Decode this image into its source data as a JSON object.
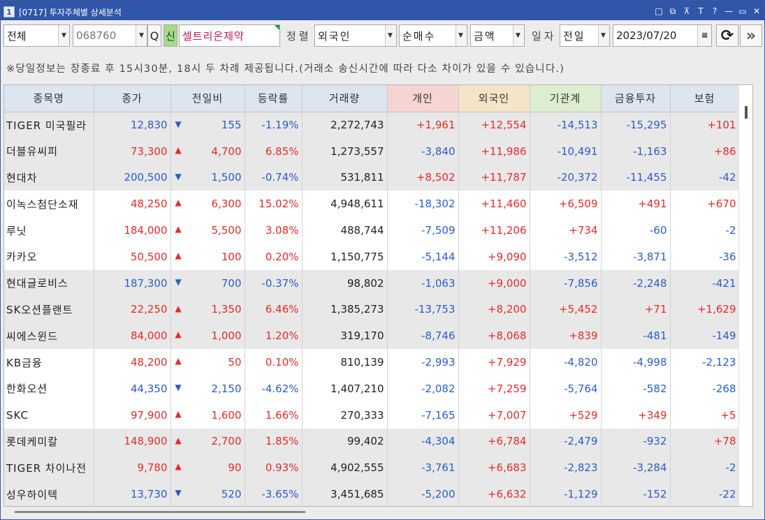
{
  "window": {
    "number": "1",
    "title": "[0717] 투자주체별 상세분석",
    "title_buttons": [
      "□",
      "⧉",
      "⊼",
      "T",
      "?",
      "—",
      "▭",
      "✕"
    ]
  },
  "toolbar": {
    "market": "전체",
    "code": "068760",
    "search_icon": "Q",
    "badge": "신",
    "stock_name": "셀트리온제약",
    "sort_label": "정렬",
    "sort_by": "외국인",
    "trade_type": "순매수",
    "unit": "금액",
    "date_label": "일자",
    "date_mode": "전일",
    "date": "2023/07/20",
    "calendar_icon": "▦",
    "refresh_icon": "⟳",
    "next_icon": "»"
  },
  "notice": "※당일정보는 장종료 후 15시30분, 18시 두 차례 제공됩니다.(거래소 송신시간에 따라 다소 차이가 있을 수 있습니다.)",
  "table": {
    "headers": [
      "종목명",
      "종가",
      "전일비",
      "등락률",
      "거래량",
      "개인",
      "외국인",
      "기관계",
      "금융투자",
      "보험"
    ],
    "rows": [
      {
        "name": "TIGER 미국필라",
        "price": "12,830",
        "dir": "dn",
        "chg": "155",
        "rate": "-1.19%",
        "vol": "2,272,743",
        "ind": "+1,961",
        "for": "+12,554",
        "ins": "-14,513",
        "fin": "-15,295",
        "insu": "+101"
      },
      {
        "name": "더블유씨피",
        "price": "73,300",
        "dir": "up",
        "chg": "4,700",
        "rate": "6.85%",
        "vol": "1,273,557",
        "ind": "-3,840",
        "for": "+11,986",
        "ins": "-10,491",
        "fin": "-1,163",
        "insu": "+86"
      },
      {
        "name": "현대차",
        "price": "200,500",
        "dir": "dn",
        "chg": "1,500",
        "rate": "-0.74%",
        "vol": "531,811",
        "ind": "+8,502",
        "for": "+11,787",
        "ins": "-20,372",
        "fin": "-11,455",
        "insu": "-42"
      },
      {
        "name": "이녹스첨단소재",
        "price": "48,250",
        "dir": "up",
        "chg": "6,300",
        "rate": "15.02%",
        "vol": "4,948,611",
        "ind": "-18,302",
        "for": "+11,460",
        "ins": "+6,509",
        "fin": "+491",
        "insu": "+670"
      },
      {
        "name": "루닛",
        "price": "184,000",
        "dir": "up",
        "chg": "5,500",
        "rate": "3.08%",
        "vol": "488,744",
        "ind": "-7,509",
        "for": "+11,206",
        "ins": "+734",
        "fin": "-60",
        "insu": "-2"
      },
      {
        "name": "카카오",
        "price": "50,500",
        "dir": "up",
        "chg": "100",
        "rate": "0.20%",
        "vol": "1,150,775",
        "ind": "-5,144",
        "for": "+9,090",
        "ins": "-3,512",
        "fin": "-3,871",
        "insu": "-36"
      },
      {
        "name": "현대글로비스",
        "price": "187,300",
        "dir": "dn",
        "chg": "700",
        "rate": "-0.37%",
        "vol": "98,802",
        "ind": "-1,063",
        "for": "+9,000",
        "ins": "-7,856",
        "fin": "-2,248",
        "insu": "-421"
      },
      {
        "name": "SK오션플랜트",
        "price": "22,250",
        "dir": "up",
        "chg": "1,350",
        "rate": "6.46%",
        "vol": "1,385,273",
        "ind": "-13,753",
        "for": "+8,200",
        "ins": "+5,452",
        "fin": "+71",
        "insu": "+1,629"
      },
      {
        "name": "씨에스윈드",
        "price": "84,000",
        "dir": "up",
        "chg": "1,000",
        "rate": "1.20%",
        "vol": "319,170",
        "ind": "-8,746",
        "for": "+8,068",
        "ins": "+839",
        "fin": "-481",
        "insu": "-149"
      },
      {
        "name": "KB금융",
        "price": "48,200",
        "dir": "up",
        "chg": "50",
        "rate": "0.10%",
        "vol": "810,139",
        "ind": "-2,993",
        "for": "+7,929",
        "ins": "-4,820",
        "fin": "-4,998",
        "insu": "-2,123"
      },
      {
        "name": "한화오션",
        "price": "44,350",
        "dir": "dn",
        "chg": "2,150",
        "rate": "-4.62%",
        "vol": "1,407,210",
        "ind": "-2,082",
        "for": "+7,259",
        "ins": "-5,764",
        "fin": "-582",
        "insu": "-268"
      },
      {
        "name": "SKC",
        "price": "97,900",
        "dir": "up",
        "chg": "1,600",
        "rate": "1.66%",
        "vol": "270,333",
        "ind": "-7,165",
        "for": "+7,007",
        "ins": "+529",
        "fin": "+349",
        "insu": "+5"
      },
      {
        "name": "롯데케미칼",
        "price": "148,900",
        "dir": "up",
        "chg": "2,700",
        "rate": "1.85%",
        "vol": "99,402",
        "ind": "-4,304",
        "for": "+6,784",
        "ins": "-2,479",
        "fin": "-932",
        "insu": "+78"
      },
      {
        "name": "TIGER 차이나전",
        "price": "9,780",
        "dir": "up",
        "chg": "90",
        "rate": "0.93%",
        "vol": "4,902,555",
        "ind": "-3,761",
        "for": "+6,683",
        "ins": "-2,823",
        "fin": "-3,284",
        "insu": "-2"
      },
      {
        "name": "성우하이텍",
        "price": "13,730",
        "dir": "dn",
        "chg": "520",
        "rate": "-3.65%",
        "vol": "3,451,685",
        "ind": "-5,200",
        "for": "+6,632",
        "ins": "-1,129",
        "fin": "-152",
        "insu": "-22"
      }
    ]
  },
  "colors": {
    "up": "#e52a2a",
    "down": "#2b5cc8",
    "title_bar": "#2f56a8"
  }
}
